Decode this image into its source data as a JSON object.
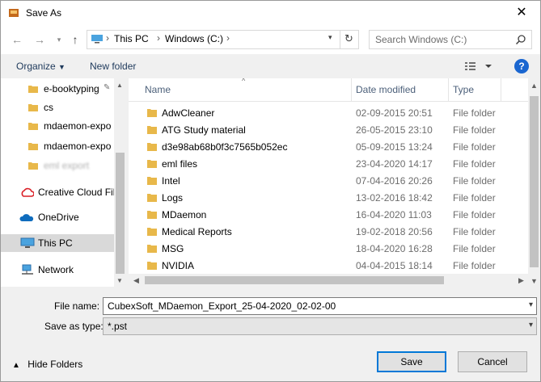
{
  "window": {
    "title": "Save As"
  },
  "address_bar": {
    "crumbs": [
      "This PC",
      "Windows (C:)"
    ]
  },
  "search": {
    "placeholder": "Search Windows (C:)"
  },
  "toolbar": {
    "organize_label": "Organize",
    "new_folder_label": "New folder",
    "help_label": "?"
  },
  "nav_pane": {
    "items": [
      {
        "label": "e-booktyping",
        "icon": "folder-icon"
      },
      {
        "label": "cs",
        "icon": "folder-icon"
      },
      {
        "label": "mdaemon-expo",
        "icon": "folder-icon"
      },
      {
        "label": "mdaemon-expo",
        "icon": "folder-icon"
      },
      {
        "label": "eml export",
        "icon": "folder-icon"
      },
      {
        "label": "Creative Cloud Fil",
        "icon": "creative-cloud-icon"
      },
      {
        "label": "OneDrive",
        "icon": "onedrive-icon"
      },
      {
        "label": "This PC",
        "icon": "computer-icon"
      },
      {
        "label": "Network",
        "icon": "network-icon"
      }
    ]
  },
  "file_list": {
    "columns": {
      "name": "Name",
      "date": "Date modified",
      "type": "Type"
    },
    "rows": [
      {
        "name": "AdwCleaner",
        "date": "02-09-2015 20:51",
        "type": "File folder"
      },
      {
        "name": "ATG Study material",
        "date": "26-05-2015 23:10",
        "type": "File folder"
      },
      {
        "name": "d3e98ab68b0f3c7565b052ec",
        "date": "05-09-2015 13:24",
        "type": "File folder"
      },
      {
        "name": "eml files",
        "date": "23-04-2020 14:17",
        "type": "File folder"
      },
      {
        "name": "Intel",
        "date": "07-04-2016 20:26",
        "type": "File folder"
      },
      {
        "name": "Logs",
        "date": "13-02-2016 18:42",
        "type": "File folder"
      },
      {
        "name": "MDaemon",
        "date": "16-04-2020 11:03",
        "type": "File folder"
      },
      {
        "name": "Medical Reports",
        "date": "19-02-2018 20:56",
        "type": "File folder"
      },
      {
        "name": "MSG",
        "date": "18-04-2020 16:28",
        "type": "File folder"
      },
      {
        "name": "NVIDIA",
        "date": "04-04-2015 18:14",
        "type": "File folder"
      }
    ]
  },
  "form": {
    "file_name_label": "File name:",
    "file_name_value": "CubexSoft_MDaemon_Export_25-04-2020_02-02-00",
    "save_type_label": "Save as type:",
    "save_type_value": "*.pst"
  },
  "footer": {
    "hide_folders_label": "Hide Folders",
    "save_label": "Save",
    "cancel_label": "Cancel"
  },
  "colors": {
    "accent": "#0078d7",
    "folder": "#e8b84a",
    "help": "#1a66d0",
    "selection": "#d9d9d9"
  }
}
